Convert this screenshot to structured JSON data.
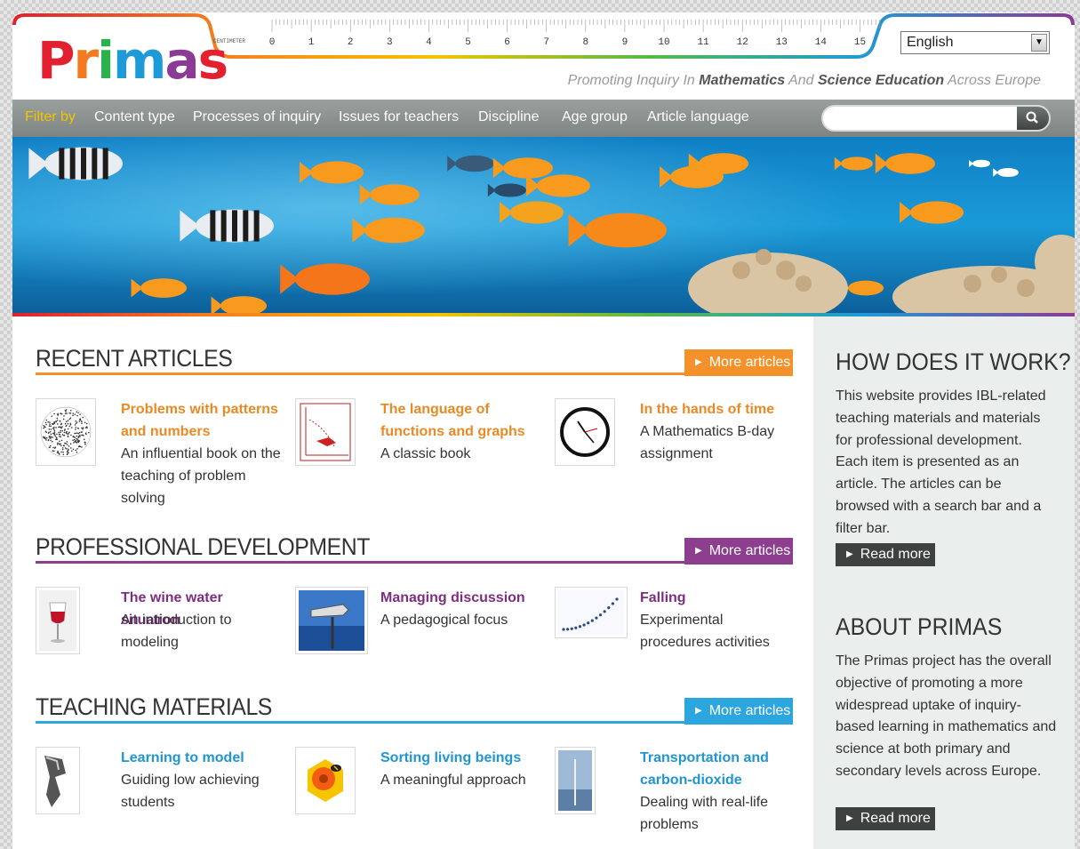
{
  "header": {
    "logo_letters": [
      "P",
      "r",
      "i",
      "m",
      "a",
      "s"
    ],
    "logo_colors": [
      "#e2202f",
      "#f47a20",
      "#2bb24c",
      "#1e9bd7",
      "#8b3a96",
      "#e2202f"
    ],
    "ruler_label": "CENTIMETER",
    "ruler_numbers": [
      "0",
      "1",
      "2",
      "3",
      "4",
      "5",
      "6",
      "7",
      "8",
      "9",
      "10",
      "11",
      "12",
      "13",
      "14",
      "15"
    ],
    "language_selected": "English",
    "tagline": {
      "p1": "Promoting Inquiry In ",
      "b1": "Mathematics",
      "p2": " And ",
      "b2": "Science Education",
      "p3": " Across Europe"
    }
  },
  "nav": {
    "filter_by": "Filter by",
    "items": [
      "Content type",
      "Processes of inquiry",
      "Issues for teachers",
      "Discipline",
      "Age group",
      "Article language"
    ],
    "search_icon": "magnifier-icon"
  },
  "colors": {
    "orange": "#f4912a",
    "purple": "#8e3e8e",
    "blue": "#2ba6df",
    "title_orange": "#e98a27",
    "title_purple": "#7d2e80",
    "title_blue": "#2095d2"
  },
  "sections": {
    "recent": {
      "title": "RECENT ARTICLES",
      "more": "More articles",
      "articles": [
        {
          "title": "Problems with patterns and numbers",
          "desc": "An influential book on the teaching of problem solving"
        },
        {
          "title": "The language of functions and graphs",
          "desc": "A classic book"
        },
        {
          "title": "In the hands of time",
          "desc": "A Mathematics B-day assignment"
        }
      ]
    },
    "professional": {
      "title": "PROFESSIONAL DEVELOPMENT",
      "more": "More articles",
      "articles": [
        {
          "title": "The wine water situation",
          "desc": "An introduction to modeling"
        },
        {
          "title": "Managing discussion",
          "desc": "A pedagogical focus"
        },
        {
          "title": "Falling",
          "desc": "Experimental procedures activities"
        }
      ]
    },
    "teaching": {
      "title": "TEACHING MATERIALS",
      "more": "More articles",
      "articles": [
        {
          "title": "Learning to model",
          "desc": "Guiding low achieving students"
        },
        {
          "title": "Sorting living beings",
          "desc": "A meaningful approach"
        },
        {
          "title": "Transportation and carbon-dioxide",
          "desc": "Dealing with real-life problems"
        }
      ]
    }
  },
  "sidebar": {
    "how": {
      "title": "HOW DOES IT WORK?",
      "text": "This website provides IBL-related teaching materials and materials for professional development. Each item is presented as an article. The articles can be browsed with a search bar and a filter bar.",
      "button": "Read more"
    },
    "about": {
      "title": "ABOUT PRIMAS",
      "text": "The Primas project has the overall objective of promoting a more widespread uptake of inquiry-based learning in mathematics and science at both primary and secondary levels across Europe.",
      "button": "Read more"
    }
  }
}
